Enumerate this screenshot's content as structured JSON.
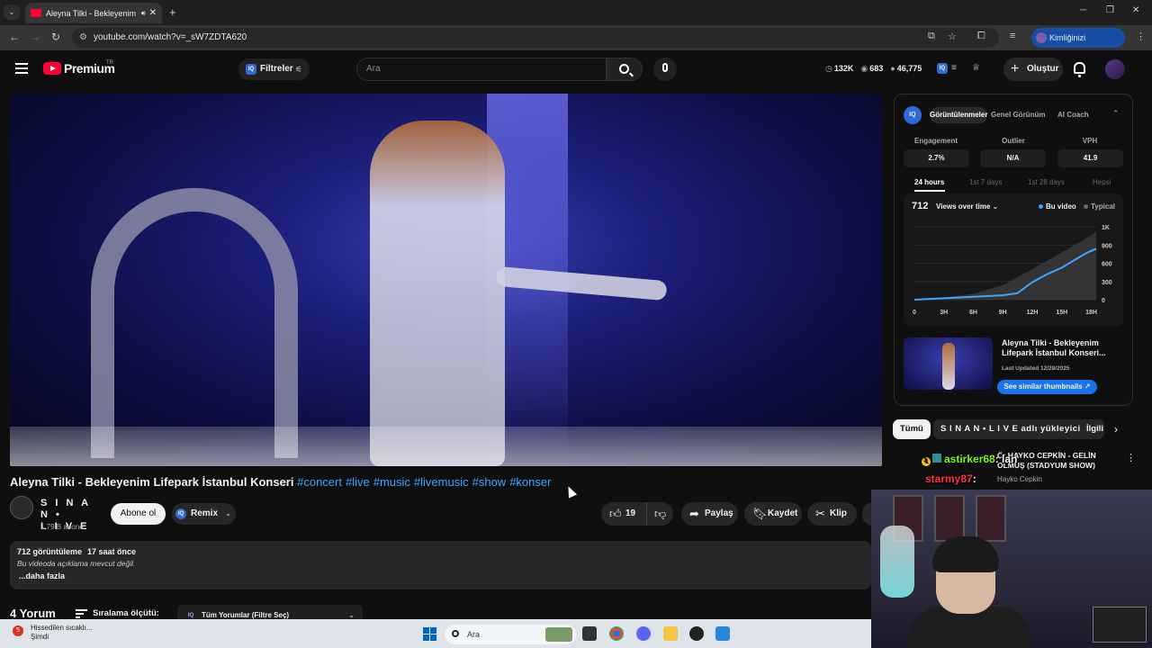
{
  "browser": {
    "tab_title": "Aleyna Tilki - Bekleyenim Lif",
    "url": "youtube.com/watch?v=_sW7ZDTA620",
    "verify_label": "Kimliğinizi doğrulayın"
  },
  "header": {
    "logo_text": "Premium",
    "region": "TR",
    "filters_label": "Filtreler",
    "search_placeholder": "Ara",
    "create_label": "Oluştur",
    "stats": [
      "132K",
      "683",
      "46,775"
    ]
  },
  "video": {
    "title": "Aleyna Tilki - Bekleyenim Lifepark İstanbul Konseri",
    "hashtags": [
      "#concert",
      "#live",
      "#music",
      "#livemusic",
      "#show",
      "#konser"
    ],
    "channel_name": "S I N A N •\nL I V E",
    "subscribers": "1,79 B abone",
    "subscribe_label": "Abone ol",
    "remix_label": "Remix",
    "like_count": "19",
    "share_label": "Paylaş",
    "save_label": "Kaydet",
    "clip_label": "Klip"
  },
  "description": {
    "views": "712 görüntüleme",
    "age": "17 saat önce",
    "empty_text": "Bu videoda açıklama mevcut değil.",
    "more_label": "...daha fazla"
  },
  "comments": {
    "count_label": "4 Yorum",
    "sort_label": "Sıralama ölçütü:",
    "filter_label": "Tüm Yorumlar (Filtre Seç)"
  },
  "iq_panel": {
    "logo": "IQ",
    "tabs": [
      "Görüntülenmeler",
      "Genel Görünüm",
      "AI Coach"
    ],
    "metrics": [
      {
        "label": "Engagement",
        "value": "2.7%"
      },
      {
        "label": "Outlier",
        "value": "N/A"
      },
      {
        "label": "VPH",
        "value": "41.9"
      }
    ],
    "ranges": [
      "24 hours",
      "1st 7 days",
      "1st 28 days",
      "Hepsi"
    ],
    "chart_total": "712",
    "chart_mode": "Views over time ⌄",
    "legend": [
      "Bu video",
      "Typical"
    ],
    "thumb_title": "Aleyna Tilki - Bekleyenim Lifepark İstanbul Konseri...",
    "thumb_updated": "Last Updated 12/28/2025",
    "similar_label": "See similar thumbnails ↗"
  },
  "chart_data": {
    "type": "line",
    "x": [
      "0",
      "3H",
      "6H",
      "9H",
      "12H",
      "15H",
      "18H"
    ],
    "y_ticks": [
      "0",
      "300",
      "600",
      "900",
      "1K"
    ],
    "ylim": [
      0,
      1000
    ],
    "series": [
      {
        "name": "Bu video",
        "color": "#3ea6ff",
        "points": [
          [
            0,
            0
          ],
          [
            3,
            20
          ],
          [
            6,
            40
          ],
          [
            9,
            60
          ],
          [
            10.5,
            90
          ],
          [
            12,
            240
          ],
          [
            13.5,
            350
          ],
          [
            15,
            440
          ],
          [
            16.5,
            560
          ],
          [
            17.5,
            640
          ],
          [
            18.5,
            700
          ]
        ]
      },
      {
        "name": "Typical",
        "color": "#555555",
        "points": [
          [
            0,
            0
          ],
          [
            3,
            30
          ],
          [
            6,
            80
          ],
          [
            9,
            200
          ],
          [
            12,
            420
          ],
          [
            15,
            650
          ],
          [
            18,
            880
          ],
          [
            18.5,
            940
          ]
        ]
      }
    ]
  },
  "chips": [
    "Tümü",
    "S I N A N • L I V E adlı yükleyiciden",
    "İlgili"
  ],
  "recommendation": {
    "title": "Ö: HAYKO CEPKİN - GELİN OLMUŞ (STADYUM SHOW)",
    "channel": "Hayko Cepkin"
  },
  "chat": [
    {
      "user": "astirker68",
      "text": ": lan"
    },
    {
      "user": "starmy87",
      "text": ":"
    }
  ],
  "taskbar": {
    "weather_line1": "Hissedilen sıcaklı...",
    "weather_line2": "Şimdi",
    "weather_badge": "5",
    "search_label": "Ara"
  }
}
